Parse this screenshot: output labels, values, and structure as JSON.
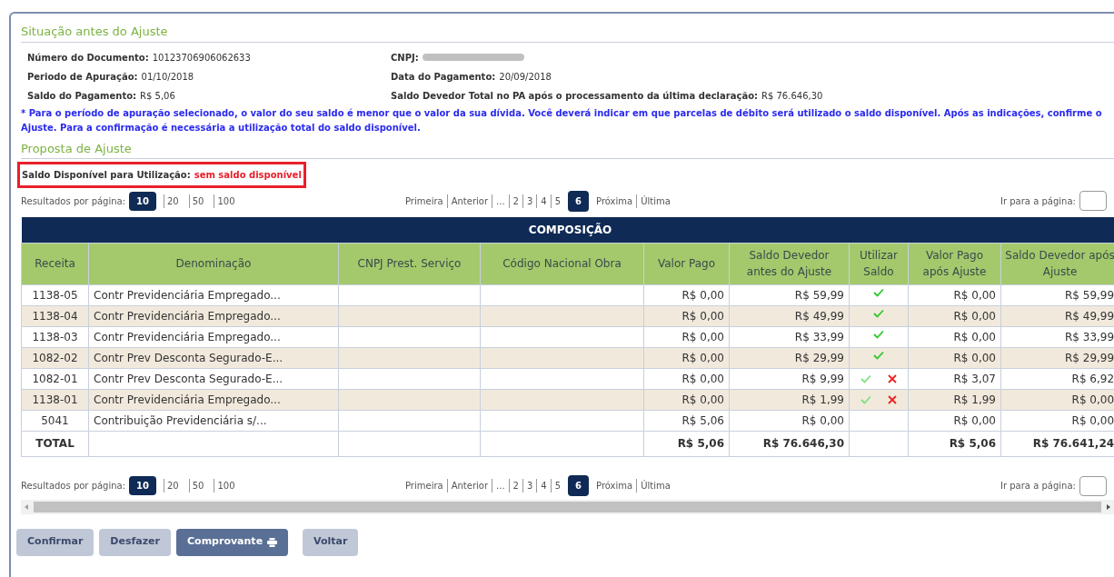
{
  "section_before": {
    "title": "Situação antes do Ajuste",
    "fields_left": [
      {
        "label": "Número do Documento:",
        "value": "10123706906062633"
      },
      {
        "label": "Periodo de Apuração:",
        "value": "01/10/2018"
      },
      {
        "label": "Saldo do Pagamento:",
        "value": "R$ 5,06"
      }
    ],
    "fields_right": [
      {
        "label": "CNPJ:",
        "redacted": true
      },
      {
        "label": "Data do Pagamento:",
        "value": "20/09/2018",
        "redacted": false
      },
      {
        "label": "Saldo Devedor Total no PA após o processamento da última declaração:",
        "value": "R$ 76.646,30",
        "redacted": false
      }
    ],
    "notice": "* Para o período de apuração selecionado, o valor do seu saldo é menor que o valor da sua dívida. Você deverá indicar em que parcelas de débito será utilizado o saldo disponível. Após as indicações, confirme o Ajuste. Para a confirmação é necessária a utilização total do saldo disponível."
  },
  "section_proposal": {
    "title": "Proposta de Ajuste",
    "balance_label": "Saldo Disponível para Utilização:",
    "balance_value": "sem saldo disponível"
  },
  "pagination": [
    {
      "per_page_label": "Resultados por página:",
      "per_page": [
        {
          "label": "10",
          "selected": true
        },
        {
          "label": "20",
          "selected": false
        },
        {
          "label": "50",
          "selected": false
        },
        {
          "label": "100",
          "selected": false
        }
      ],
      "pages": [
        {
          "label": "Primeira",
          "selected": false
        },
        {
          "label": "Anterior",
          "selected": false
        },
        {
          "label": "...",
          "selected": false
        },
        {
          "label": "2",
          "selected": false
        },
        {
          "label": "3",
          "selected": false
        },
        {
          "label": "4",
          "selected": false
        },
        {
          "label": "5",
          "selected": false
        },
        {
          "label": "6",
          "selected": true
        },
        {
          "label": "Próxima",
          "selected": false
        },
        {
          "label": "Última",
          "selected": false
        }
      ],
      "goto_label": "Ir para a página:"
    },
    {
      "per_page_label": "Resultados por página:",
      "per_page": [
        {
          "label": "10",
          "selected": true
        },
        {
          "label": "20",
          "selected": false
        },
        {
          "label": "50",
          "selected": false
        },
        {
          "label": "100",
          "selected": false
        }
      ],
      "pages": [
        {
          "label": "Primeira",
          "selected": false
        },
        {
          "label": "Anterior",
          "selected": false
        },
        {
          "label": "...",
          "selected": false
        },
        {
          "label": "2",
          "selected": false
        },
        {
          "label": "3",
          "selected": false
        },
        {
          "label": "4",
          "selected": false
        },
        {
          "label": "5",
          "selected": false
        },
        {
          "label": "6",
          "selected": true
        },
        {
          "label": "Próxima",
          "selected": false
        },
        {
          "label": "Última",
          "selected": false
        }
      ],
      "goto_label": "Ir para a página:"
    }
  ],
  "table": {
    "title": "COMPOSIÇÃO",
    "columns": [
      "Receita",
      "Denominação",
      "CNPJ Prest. Serviço",
      "Código Nacional Obra",
      "Valor Pago",
      "Saldo Devedor antes do Ajuste",
      "Utilizar Saldo",
      "Valor Pago após Ajuste",
      "Saldo Devedor após Ajuste"
    ],
    "rows": [
      {
        "receita": "1138-05",
        "denominacao": "Contr Previdenciária Empregado...",
        "valor_pago": "R$ 0,00",
        "saldo_antes": "R$ 59,99",
        "use_balance": true,
        "removable": false,
        "valor_apos": "R$ 0,00",
        "saldo_apos": "R$ 59,99"
      },
      {
        "receita": "1138-04",
        "denominacao": "Contr Previdenciária Empregado...",
        "valor_pago": "R$ 0,00",
        "saldo_antes": "R$ 49,99",
        "use_balance": true,
        "removable": false,
        "valor_apos": "R$ 0,00",
        "saldo_apos": "R$ 49,99"
      },
      {
        "receita": "1138-03",
        "denominacao": "Contr Previdenciária Empregado...",
        "valor_pago": "R$ 0,00",
        "saldo_antes": "R$ 33,99",
        "use_balance": true,
        "removable": false,
        "valor_apos": "R$ 0,00",
        "saldo_apos": "R$ 33,99"
      },
      {
        "receita": "1082-02",
        "denominacao": "Contr Prev Desconta Segurado-E...",
        "valor_pago": "R$ 0,00",
        "saldo_antes": "R$ 29,99",
        "use_balance": true,
        "removable": false,
        "valor_apos": "R$ 0,00",
        "saldo_apos": "R$ 29,99"
      },
      {
        "receita": "1082-01",
        "denominacao": "Contr Prev Desconta Segurado-E...",
        "valor_pago": "R$ 0,00",
        "saldo_antes": "R$ 9,99",
        "use_balance": true,
        "removable": true,
        "valor_apos": "R$ 3,07",
        "saldo_apos": "R$ 6,92"
      },
      {
        "receita": "1138-01",
        "denominacao": "Contr Previdenciária Empregado...",
        "valor_pago": "R$ 0,00",
        "saldo_antes": "R$ 1,99",
        "use_balance": true,
        "removable": true,
        "valor_apos": "R$ 1,99",
        "saldo_apos": "R$ 0,00"
      },
      {
        "receita": "5041",
        "denominacao": "Contribuição Previdenciária s/...",
        "valor_pago": "R$ 5,06",
        "saldo_antes": "R$ 0,00",
        "use_balance": false,
        "removable": false,
        "valor_apos": "R$ 0,00",
        "saldo_apos": "R$ 0,00"
      }
    ],
    "total": {
      "label": "TOTAL",
      "valor_pago": "R$ 5,06",
      "saldo_antes": "R$ 76.646,30",
      "valor_apos": "R$ 5,06",
      "saldo_apos": "R$ 76.641,24"
    }
  },
  "buttons": [
    {
      "label": "Confirmar",
      "kind": "plain"
    },
    {
      "label": "Desfazer",
      "kind": "plain"
    },
    {
      "label": "Comprovante",
      "kind": "print"
    },
    {
      "label": "Voltar",
      "kind": "plain"
    }
  ]
}
